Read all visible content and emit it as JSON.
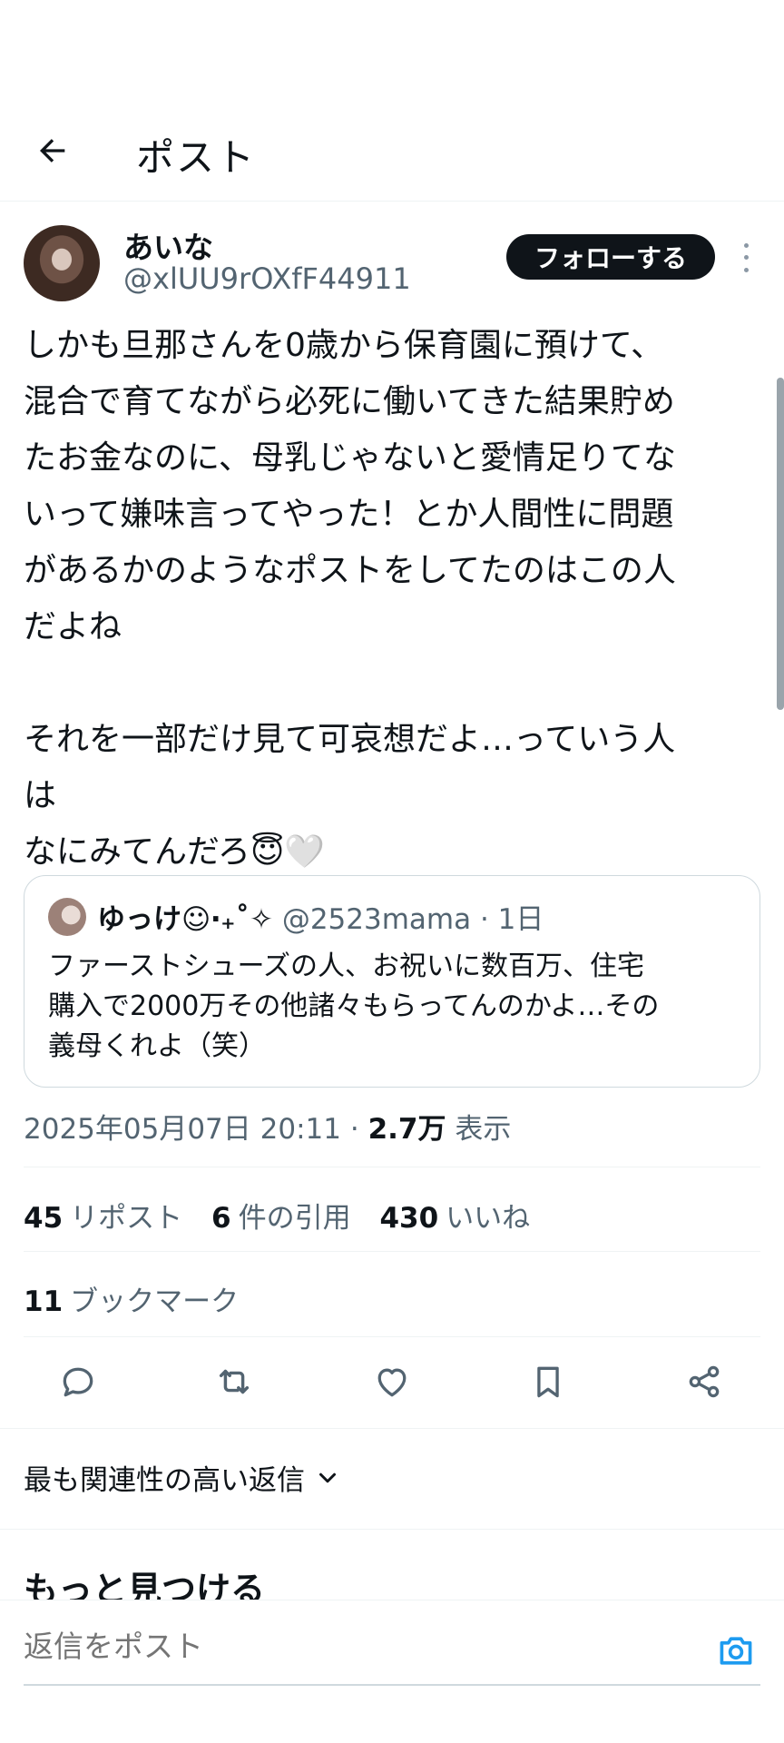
{
  "header": {
    "title": "ポスト"
  },
  "post": {
    "author_name": "あいな",
    "author_handle": "@xlUU9rOXfF44911",
    "follow_label": "フォローする",
    "text": "しかも旦那さんを0歳から保育園に預けて、\n混合で育てながら必死に働いてきた結果貯め\nたお金なのに、母乳じゃないと愛情足りてな\nいって嫌味言ってやった！とか人間性に問題\nがあるかのようなポストをしてたのはこの人\nだよね\n\nそれを一部だけ見て可哀想だよ…っていう人\nは\nなにみてんだろ😇🤍",
    "quote": {
      "name": "ゆっけ☺︎‧₊˚✧",
      "handle": "@2523mama",
      "time": "1日",
      "text": "ファーストシューズの人、お祝いに数百万、住宅\n購入で2000万その他諸々もらってんのかよ…その\n義母くれよ（笑）"
    },
    "timestamp": "2025年05月07日 20:11",
    "views_count": "2.7万",
    "views_label": "表示",
    "stats": {
      "reposts_count": "45",
      "reposts_label": "リポスト",
      "quotes_count": "6",
      "quotes_label": "件の引用",
      "likes_count": "430",
      "likes_label": "いいね",
      "bookmarks_count": "11",
      "bookmarks_label": "ブックマーク"
    }
  },
  "actions": [
    "reply-icon",
    "repost-icon",
    "like-icon",
    "bookmark-icon",
    "share-icon"
  ],
  "replies": {
    "sort_label": "最も関連性の高い返信"
  },
  "discover": {
    "title": "もっと見つける"
  },
  "reply_bar": {
    "placeholder": "返信をポスト"
  },
  "colors": {
    "accent": "#1d9bf0",
    "text": "#0f1419",
    "secondary": "#536471"
  }
}
